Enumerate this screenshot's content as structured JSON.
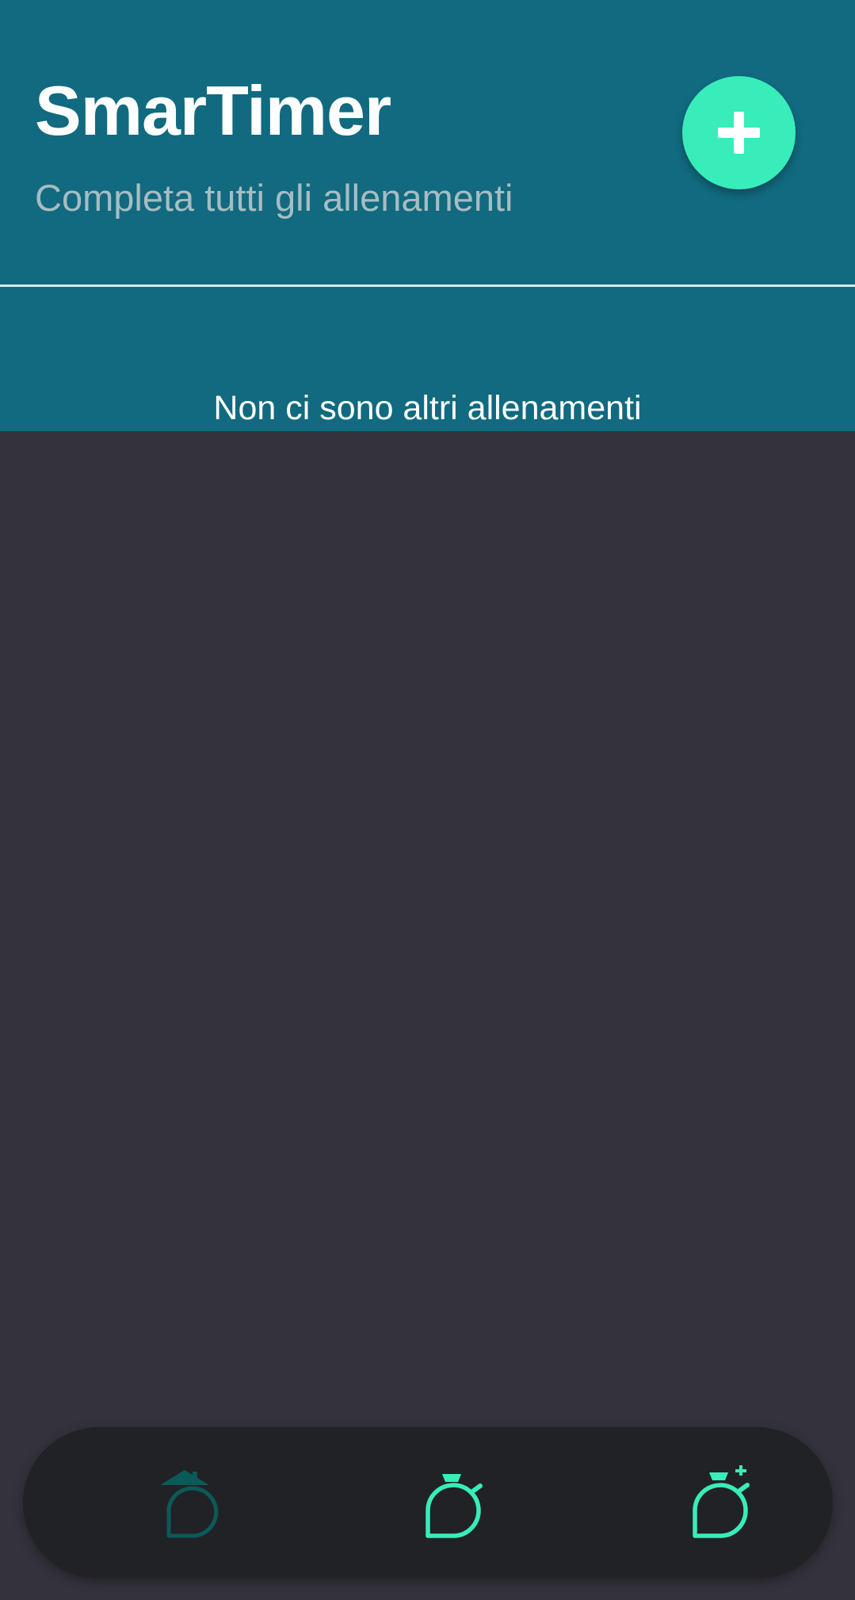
{
  "app": {
    "title": "SmarTimer",
    "subtitle": "Completa tutti gli allenamenti"
  },
  "add_button": {
    "icon": "plus-icon"
  },
  "workouts": {
    "empty_message": "Non ci sono altri allenamenti"
  },
  "bottom_nav": {
    "items": [
      {
        "id": "home",
        "icon": "home-timer-icon",
        "active": true
      },
      {
        "id": "timer",
        "icon": "stopwatch-icon",
        "active": false
      },
      {
        "id": "new-timer",
        "icon": "stopwatch-plus-icon",
        "active": false
      }
    ]
  },
  "colors": {
    "header_bg": "#116a7f",
    "page_bg": "#34333d",
    "accent": "#38edba",
    "nav_bg": "#212226",
    "active_nav_icon": "#0a5a57"
  }
}
